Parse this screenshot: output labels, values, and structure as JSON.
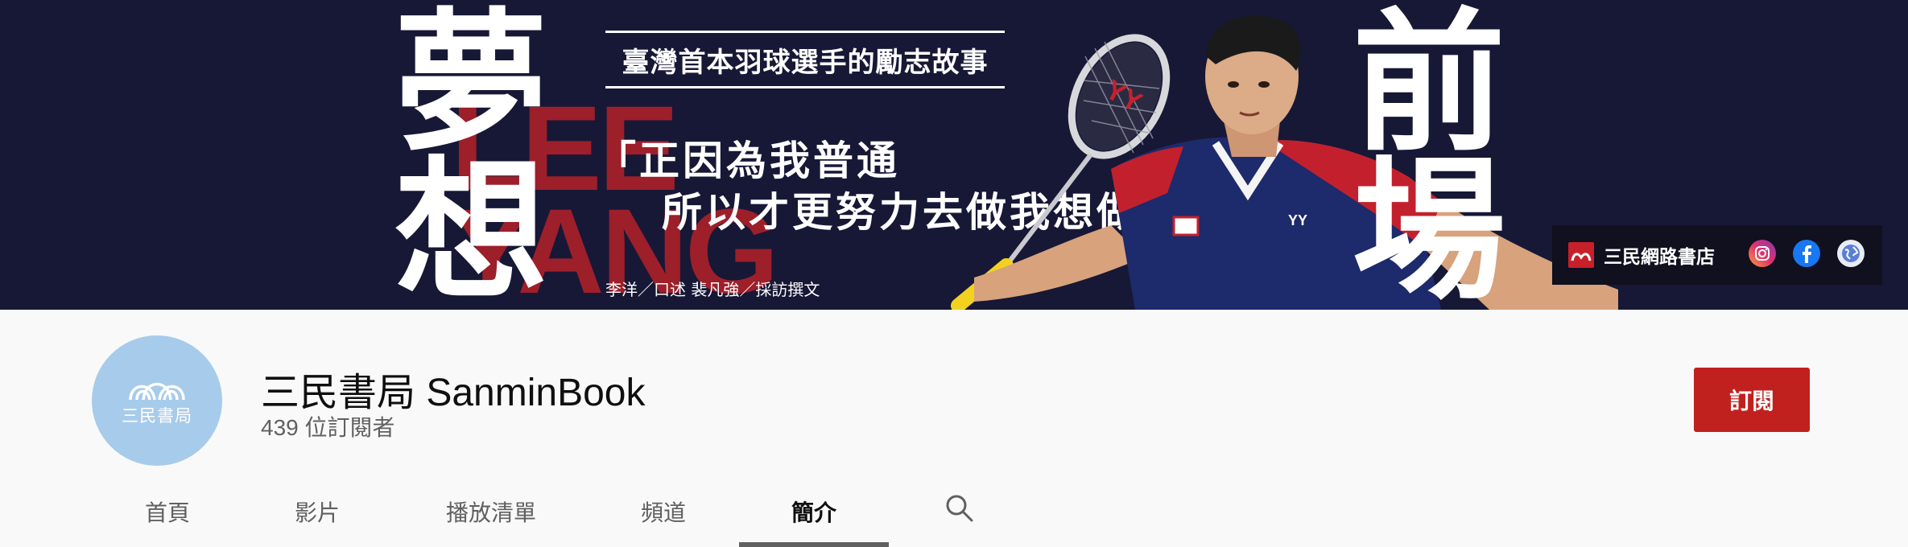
{
  "banner": {
    "char_dream_1": "夢",
    "char_dream_2": "想",
    "char_front_1": "前",
    "char_front_2": "場",
    "lee_yang_line1": "LEE",
    "lee_yang_line2": "YANG",
    "tagline": "臺灣首本羽球選手的勵志故事",
    "quote_line1": "「正因為我普通",
    "quote_line2": "所以才更努力去做我想做的」",
    "credits": "李洋／口述  裴凡強／採訪撰文",
    "store_name": "三民網路書店",
    "social_icons": [
      "instagram-icon",
      "facebook-icon",
      "globe-icon"
    ]
  },
  "channel": {
    "avatar_text": "三民書局",
    "name": "三民書局 SanminBook",
    "subscribers": "439 位訂閱者",
    "subscribe_label": "訂閱"
  },
  "tabs": [
    {
      "label": "首頁",
      "active": false
    },
    {
      "label": "影片",
      "active": false
    },
    {
      "label": "播放清單",
      "active": false
    },
    {
      "label": "頻道",
      "active": false
    },
    {
      "label": "簡介",
      "active": true
    }
  ],
  "colors": {
    "banner_bg": "#171836",
    "accent_red": "#c0211f",
    "avatar_bg": "#a7cbea",
    "page_bg": "#f9f9f9"
  }
}
